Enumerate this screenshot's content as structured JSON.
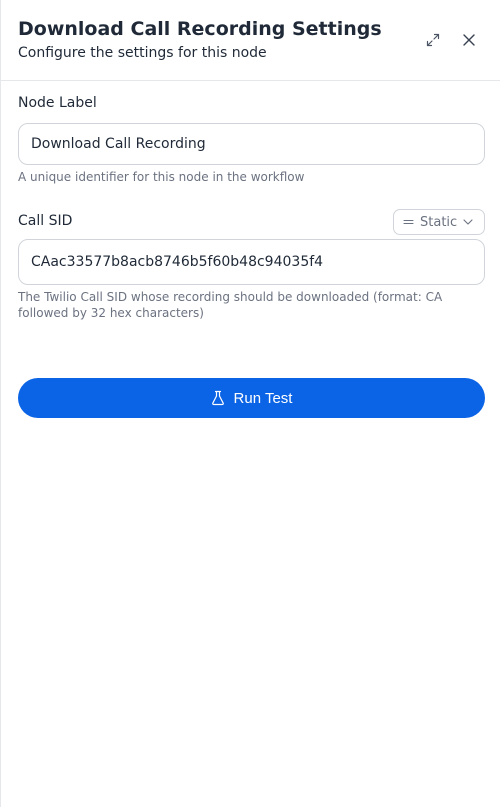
{
  "header": {
    "title": "Download Call Recording Settings",
    "subtitle": "Configure the settings for this node",
    "expand_icon": "expand-icon",
    "close_icon": "close-icon"
  },
  "node_label": {
    "label": "Node Label",
    "value": "Download Call Recording",
    "hint": "A unique identifier for this node in the workflow"
  },
  "call_sid": {
    "label": "Call SID",
    "mode": "Static",
    "value": "CAac33577b8acb8746b5f60b48c94035f4",
    "hint": "The Twilio Call SID whose recording should be downloaded (format: CA followed by 32 hex characters)"
  },
  "run_button": {
    "label": "Run Test",
    "icon": "flask-icon"
  },
  "colors": {
    "primary": "#0b63e5",
    "border": "#d1d5db",
    "hint_text": "#6b7280"
  }
}
